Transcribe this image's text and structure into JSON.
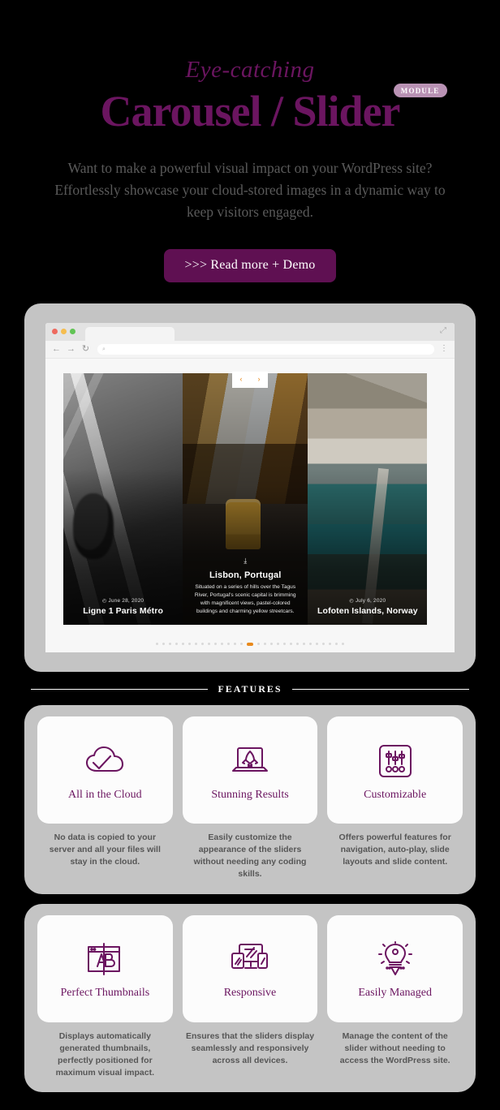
{
  "hero": {
    "eyebrow": "Eye-catching",
    "title": "Carousel / Slider",
    "badge": "MODULE",
    "subtitle": "Want to make a powerful visual impact on your WordPress site? Effortlessly showcase your cloud-stored images in a dynamic way to keep visitors engaged.",
    "cta_label": ">>> Read more + Demo",
    "accent_purple": "#6b1560",
    "cta_bg": "#5f1052",
    "badge_bg": "#b992b4"
  },
  "browser": {
    "traffic_lights": [
      "close-red",
      "minimize-yellow",
      "maximize-green"
    ],
    "back_icon": "←",
    "forward_icon": "→",
    "reload_icon": "↻",
    "search_icon": "⌕",
    "menu_icon": "⋮",
    "expand_icon": "⤢",
    "url_value": "",
    "url_placeholder": ""
  },
  "slider": {
    "prev_icon": "‹",
    "next_icon": "›",
    "download_icon": "⤓",
    "clock_icon": "◴",
    "accent": "#e8891c",
    "dot_count": 29,
    "active_dot_index": 14,
    "slides": [
      {
        "title": "Ligne 1 Paris Métro",
        "date": "June 28, 2020",
        "description": "",
        "position": "left"
      },
      {
        "title": "Lisbon, Portugal",
        "date": "",
        "description": "Situated on a series of hills over the Tagus River, Portugal's scenic capital is brimming with magnificent views, pastel-colored buildings and charming yellow streetcars.",
        "position": "center"
      },
      {
        "title": "Lofoten Islands, Norway",
        "date": "July 6, 2020",
        "description": "",
        "position": "right"
      }
    ]
  },
  "features": {
    "section_title": "FEATURES",
    "rows": [
      [
        {
          "icon": "cloud-check-icon",
          "name": "All in the Cloud",
          "description": "No data is copied to your server and all your files will stay in the cloud."
        },
        {
          "icon": "laptop-rocket-icon",
          "name": "Stunning Results",
          "description": "Easily customize the appearance of the sliders without needing any coding skills."
        },
        {
          "icon": "equalizer-sliders-icon",
          "name": "Customizable",
          "description": "Offers powerful features for navigation, auto-play, slide layouts and slide content."
        }
      ],
      [
        {
          "icon": "image-crop-ab-icon",
          "name": "Perfect Thumbnails",
          "description": "Displays automatically generated thumbnails, perfectly positioned for maximum visual impact."
        },
        {
          "icon": "multi-device-icon",
          "name": "Responsive",
          "description": "Ensures that the sliders display seamlessly and responsively across all devices."
        },
        {
          "icon": "lightbulb-pencil-icon",
          "name": "Easily Managed",
          "description": "Manage the content of the slider without needing to access the WordPress site."
        }
      ]
    ]
  }
}
